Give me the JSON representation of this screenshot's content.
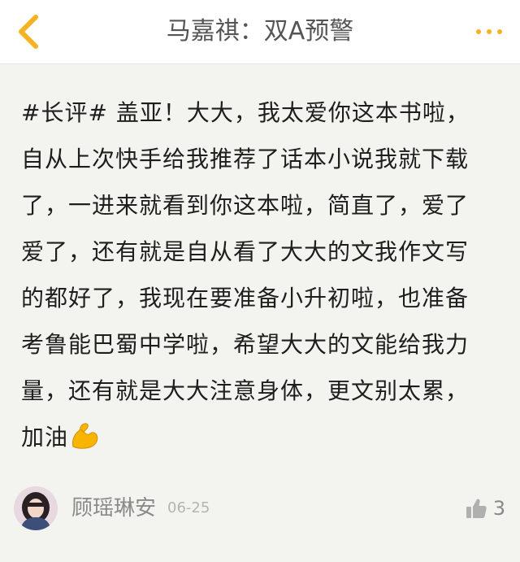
{
  "header": {
    "title": "马嘉祺：双A预警",
    "back_icon": "chevron-left-icon",
    "more_icon": "more-dots-icon"
  },
  "post": {
    "lines": [
      "#长评# 盖亚！大大，我太爱你这本书啦，",
      "自从上次快手给我推荐了话本小说我就下载",
      "了，一进来就看到你这本啦，简直了，爱了",
      "爱了，还有就是自从看了大大的文我作文写",
      "的都好了，我现在要准备小升初啦，也准备",
      "考鲁能巴蜀中学啦，希望大大的文能给我力",
      "量，还有就是大大注意身体，更文别太累，",
      "加油"
    ],
    "end_emoji": "flexed-biceps-emoji"
  },
  "footer": {
    "author": "顾瑶琳安",
    "date": "06-25",
    "like_count": "3",
    "like_icon": "thumbs-up-icon"
  },
  "colors": {
    "accent": "#f5b324",
    "background": "#f3f3ef",
    "header_bg": "#ffffff"
  }
}
